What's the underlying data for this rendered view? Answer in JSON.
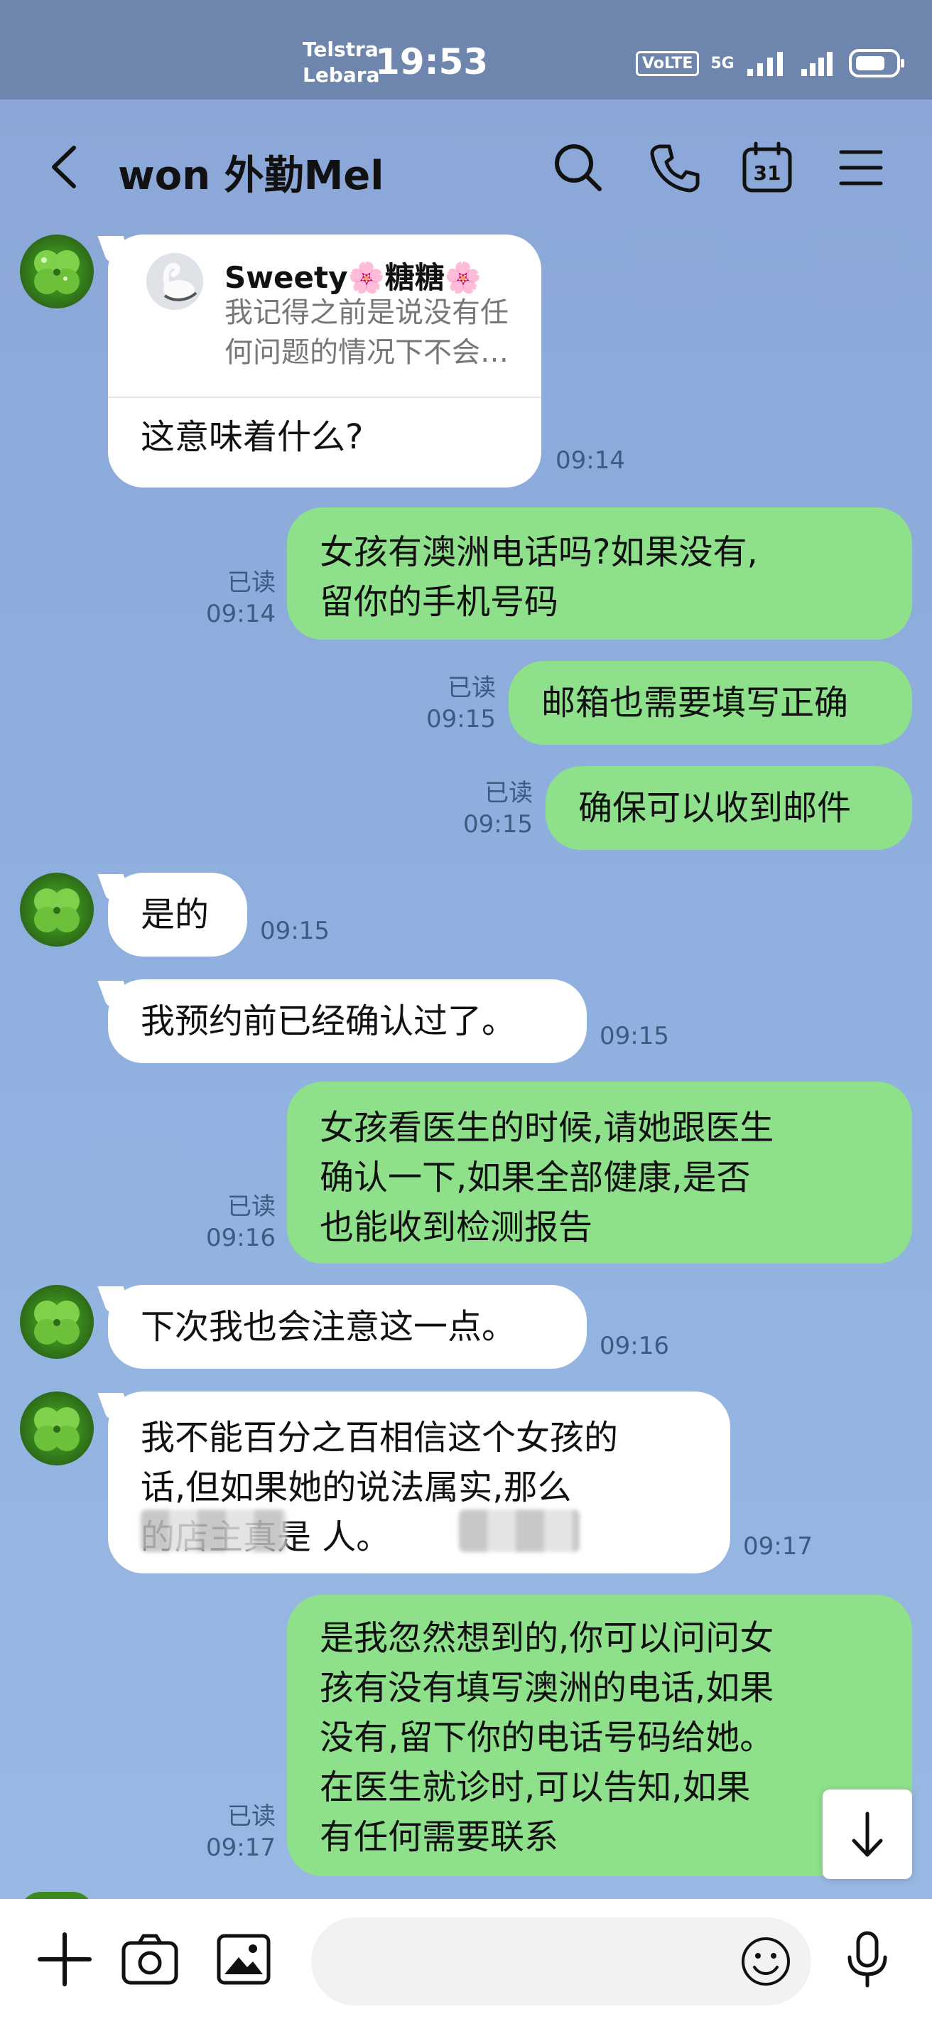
{
  "status_bar": {
    "carrier_1": "Telstra",
    "carrier_2": "Lebara",
    "time": "19:53",
    "volte": "VoLTE",
    "network": "5G"
  },
  "header": {
    "title": "won 外勤Mel",
    "calendar_day": "31"
  },
  "messages": [
    {
      "side": "in",
      "quote_name": "Sweety🌸糖糖🌸",
      "quote_text": "我记得之前是说没有任\n何问题的情况下不会…",
      "text": "这意味着什么?",
      "time": "09:14"
    },
    {
      "side": "out",
      "text": "女孩有澳洲电话吗?如果没有,\n留你的手机号码",
      "read": "已读",
      "time": "09:14"
    },
    {
      "side": "out",
      "text": "邮箱也需要填写正确",
      "read": "已读",
      "time": "09:15"
    },
    {
      "side": "out",
      "text": "确保可以收到邮件",
      "read": "已读",
      "time": "09:15"
    },
    {
      "side": "in",
      "text": "是的",
      "time": "09:15"
    },
    {
      "side": "in",
      "text": "我预约前已经确认过了。",
      "time": "09:15"
    },
    {
      "side": "out",
      "text": "女孩看医生的时候,请她跟医生\n确认一下,如果全部健康,是否\n也能收到检测报告",
      "read": "已读",
      "time": "09:16"
    },
    {
      "side": "in",
      "text": "下次我也会注意这一点。",
      "time": "09:16"
    },
    {
      "side": "in",
      "text": "我不能百分之百相信这个女孩的\n话,但如果她的说法属实,那么\n的店主真是 人。",
      "time": "09:17"
    },
    {
      "side": "out",
      "text": "是我忽然想到的,你可以问问女\n孩有没有填写澳洲的电话,如果\n没有,留下你的电话号码给她。\n在医生就诊时,可以告知,如果\n有任何需要联系",
      "read": "已读",
      "time": "09:17"
    }
  ],
  "input": {
    "placeholder": ""
  }
}
